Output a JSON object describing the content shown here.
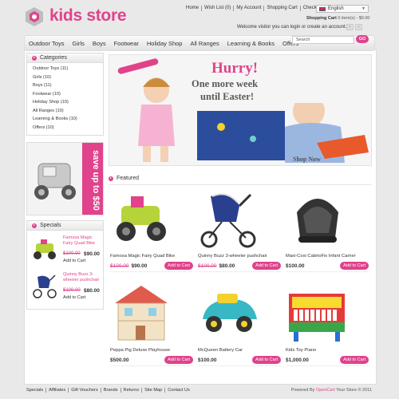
{
  "header": {
    "logo_text": "kids store",
    "top_links": [
      "Home",
      "Wish List (0)",
      "My Account",
      "Shopping Cart",
      "Checkout"
    ],
    "language": "English",
    "cart_label": "Shopping Cart",
    "cart_summary": "0 item(s) - $0.00",
    "welcome": "Welcome visitor you can login or create an account.",
    "search_placeholder": "Search",
    "go_label": "GO"
  },
  "nav": [
    "Outdoor Toys",
    "Girls",
    "Boys",
    "Footwear",
    "Holiday Shop",
    "All Ranges",
    "Learning & Books",
    "Offers"
  ],
  "categories": {
    "title": "Categories",
    "items": [
      "Outdoor Toys (11)",
      "Girls (10)",
      "Boys (11)",
      "Footwear (10)",
      "Holiday Shop (10)",
      "All Ranges (10)",
      "Learning & Books (10)",
      "Offers (10)"
    ]
  },
  "promo": {
    "text": "save up to $50"
  },
  "specials": {
    "title": "Specials",
    "items": [
      {
        "name": "Famosa Magic Fairy Quad Bike",
        "old_price": "$100.00",
        "new_price": "$90.00",
        "cart": "Add to Cart"
      },
      {
        "name": "Quinny Buzz 3-wheeler pushchair",
        "old_price": "$100.00",
        "new_price": "$80.00",
        "cart": "Add to Cart"
      }
    ]
  },
  "banner": {
    "headline": "Hurry!",
    "line2": "One more week",
    "line3": "until Easter!",
    "cta": "Shop Now"
  },
  "featured": {
    "title": "Featured",
    "items": [
      {
        "name": "Famosa Magic Fairy Quad Bike",
        "old_price": "$100.00",
        "price": "$90.00",
        "cart": "Add to Cart"
      },
      {
        "name": "Quinny Buzz 3-wheeler pushchair",
        "old_price": "$100.00",
        "price": "$80.00",
        "cart": "Add to Cart"
      },
      {
        "name": "Maxi-Cosi CabrioFix Infant Carrier",
        "old_price": "",
        "price": "$100.00",
        "cart": "Add to Cart"
      },
      {
        "name": "Peppa Pig Deluxe Playhouse",
        "old_price": "",
        "price": "$500.00",
        "cart": "Add to Cart"
      },
      {
        "name": "McQueen Battery Car",
        "old_price": "",
        "price": "$100.00",
        "cart": "Add to Cart"
      },
      {
        "name": "Kids Toy Piano",
        "old_price": "",
        "price": "$1,000.00",
        "cart": "Add to Cart"
      }
    ]
  },
  "footer": {
    "links": [
      "Specials",
      "Affiliates",
      "Gift Vouchers",
      "Brands",
      "Returns",
      "Site Map",
      "Contact Us"
    ],
    "powered_prefix": "Powered By",
    "powered_link": "OpenCart",
    "powered_suffix": "Your Store © 2011"
  },
  "colors": {
    "accent": "#e0438b",
    "background": "#e9e9e9"
  }
}
